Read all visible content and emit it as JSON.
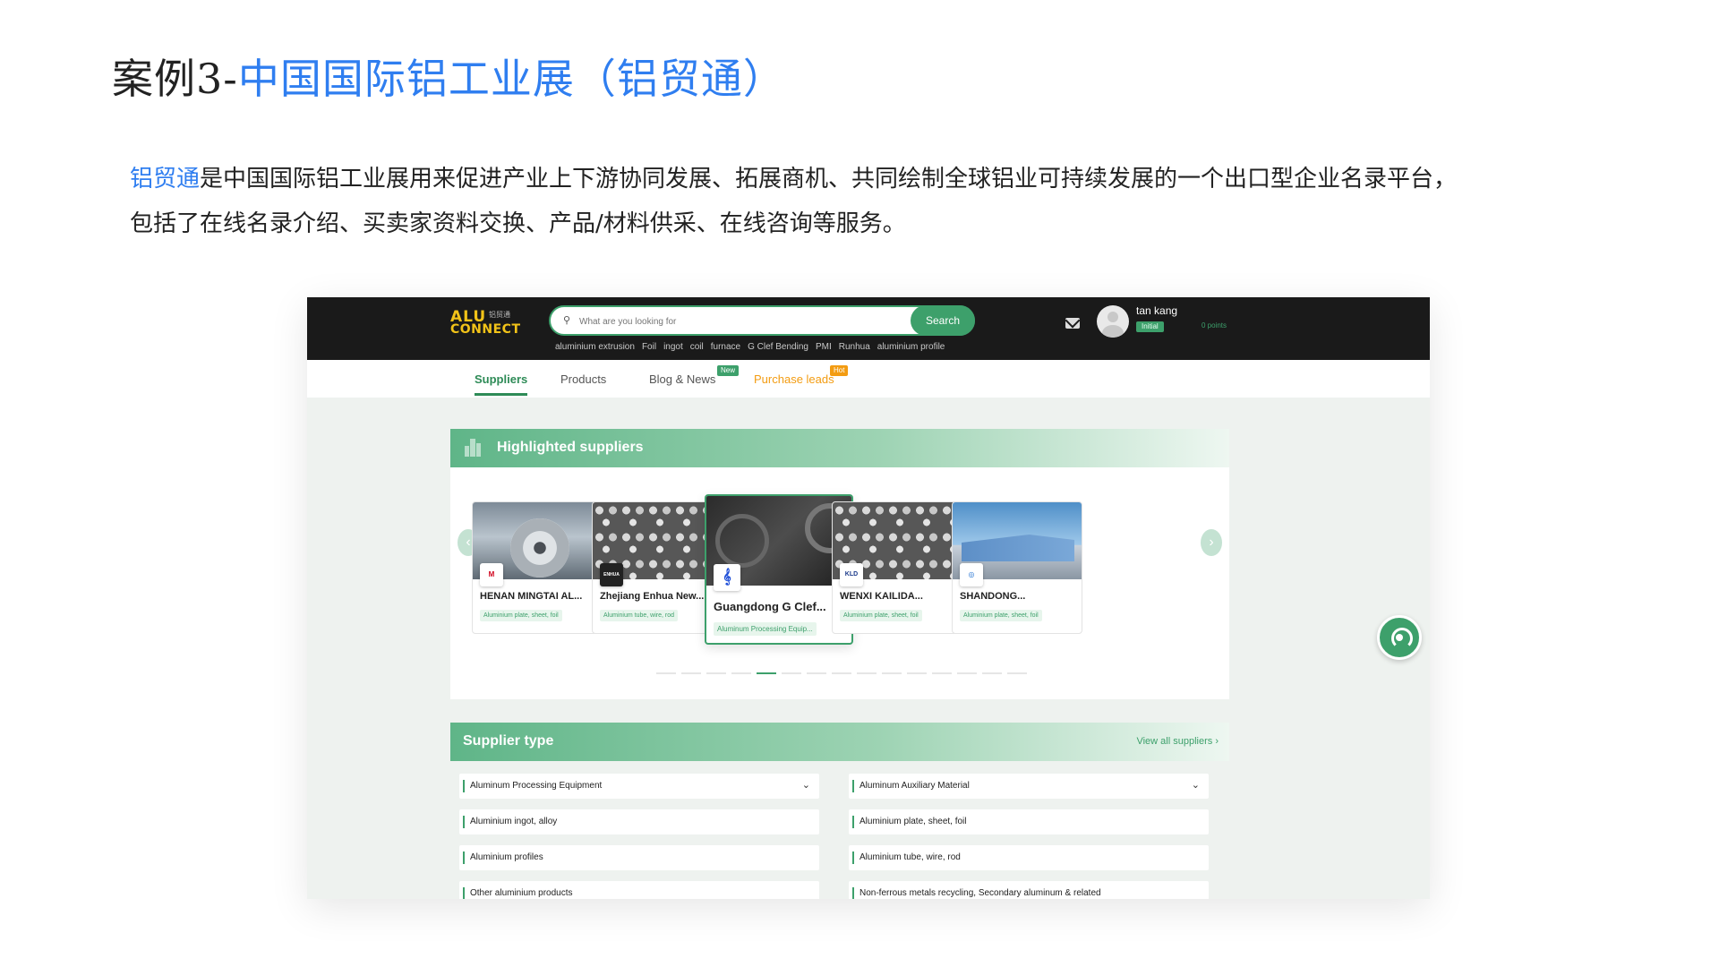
{
  "slide": {
    "title_prefix": "案例3-",
    "title_accent": "中国国际铝工业展（铝贸通）",
    "intro_brand": "铝贸通",
    "intro_line1_rest": "是中国国际铝工业展用来促进产业上下游协同发展、拓展商机、共同绘制全球铝业可持续发展的一个出口型企业名录平台，",
    "intro_line2": "包括了在线名录介绍、买卖家资料交换、产品/材料供采、在线咨询等服务。"
  },
  "header": {
    "logo_line1": "ALU",
    "logo_cn": "铝贸通",
    "logo_line2": "CONNECT",
    "search_placeholder": "What are you looking for",
    "search_button": "Search",
    "hot_words": [
      "aluminium extrusion",
      "Foil",
      "ingot",
      "coil",
      "furnace",
      "G Clef Bending",
      "PMI",
      "Runhua",
      "aluminium profile"
    ],
    "user_name": "tan kang",
    "user_level": "Initial",
    "user_points": "0 points"
  },
  "nav": {
    "suppliers": "Suppliers",
    "products": "Products",
    "blog": "Blog & News",
    "blog_tag": "New",
    "purchase": "Purchase leads",
    "purchase_tag": "Hot"
  },
  "highlighted": {
    "title": "Highlighted suppliers",
    "cards": [
      {
        "name": "HENAN MINGTAI AL...",
        "category": "Aluminium plate, sheet, foil",
        "logo": "M"
      },
      {
        "name": "Zhejiang Enhua New...",
        "category": "Aluminium tube, wire, rod",
        "logo": "ENHUA"
      },
      {
        "name": "Guangdong G Clef...",
        "category": "Aluminum Processing Equip...",
        "logo": "𝄞"
      },
      {
        "name": "WENXI KAILIDA...",
        "category": "Aluminium plate, sheet, foil",
        "logo": "KLD"
      },
      {
        "name": "SHANDONG...",
        "category": "Aluminium plate, sheet, foil",
        "logo": "◎"
      }
    ],
    "active_dot": 4,
    "dot_count": 15
  },
  "supplier_type": {
    "title": "Supplier type",
    "view_all": "View all suppliers",
    "items": [
      "Aluminum Processing Equipment",
      "Aluminum Auxiliary Material",
      "Aluminium ingot, alloy",
      "Aluminium plate, sheet, foil",
      "Aluminium profiles",
      "Aluminium tube, wire, rod",
      "Other aluminium products",
      "Non-ferrous metals recycling, Secondary aluminum & related"
    ]
  },
  "colors": {
    "accent_blue": "#2f7ef0",
    "brand_green": "#3da06b",
    "hot_orange": "#f39c12",
    "header_dark": "#1a1a1a"
  },
  "icons": {
    "search": "search-icon",
    "mail": "mail-icon",
    "support": "headset-icon",
    "chevron": "chevron-down-icon",
    "arrow_left": "arrow-left-icon",
    "arrow_right": "arrow-right-icon"
  }
}
